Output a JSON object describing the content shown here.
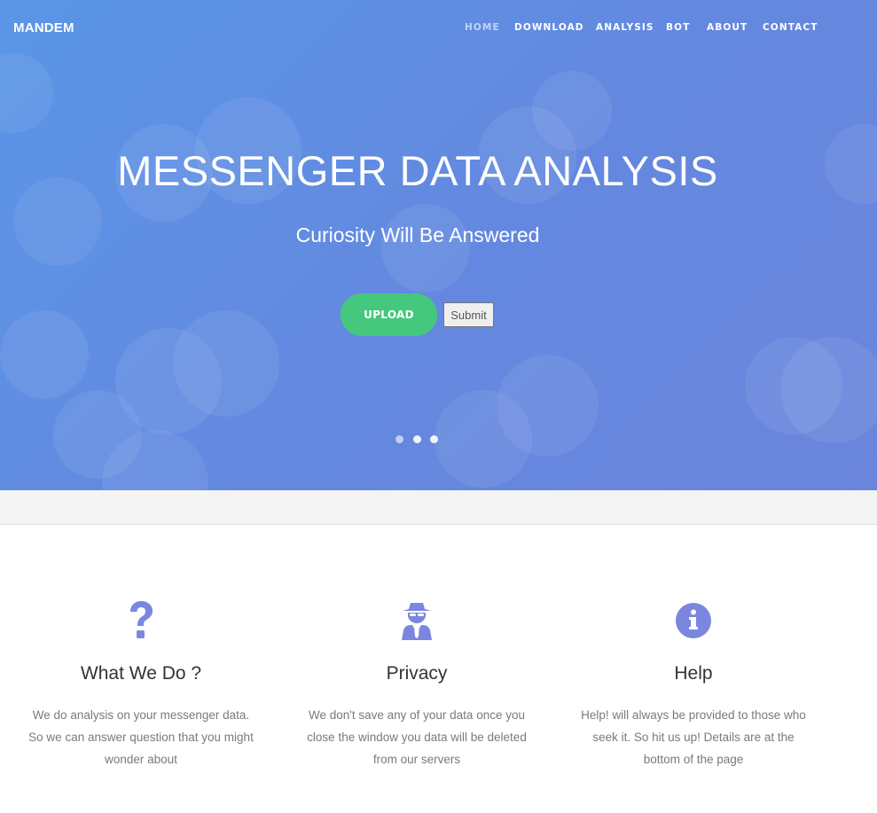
{
  "brand": "MANDEM",
  "nav": {
    "items": [
      {
        "label": "HOME",
        "active": true
      },
      {
        "label": "DOWNLOAD",
        "active": false
      },
      {
        "label": "ANALYSIS",
        "active": false
      },
      {
        "label": "BOT",
        "active": false
      },
      {
        "label": "ABOUT",
        "active": false
      },
      {
        "label": "CONTACT",
        "active": false
      }
    ]
  },
  "hero": {
    "title": "MESSENGER DATA ANALYSIS",
    "subtitle": "Curiosity Will Be Answered",
    "upload_label": "UPLOAD",
    "submit_label": "Submit",
    "slide_count": 3,
    "active_slide": 1
  },
  "features": [
    {
      "icon": "question-icon",
      "title": "What We Do ?",
      "text": "We do analysis on your messenger data. So we can answer question that you might wonder about"
    },
    {
      "icon": "spy-icon",
      "title": "Privacy",
      "text": "We don't save any of your data once you close the window you data will be deleted from our servers"
    },
    {
      "icon": "info-icon",
      "title": "Help",
      "text": "Help! will always be provided to those who seek it. So hit us up! Details are at the bottom of the page"
    }
  ],
  "colors": {
    "hero_start": "#5a96e6",
    "hero_end": "#6b86dc",
    "upload_button": "#45c87d",
    "icon": "#7b86de",
    "active_nav": "#c4d3f4"
  }
}
